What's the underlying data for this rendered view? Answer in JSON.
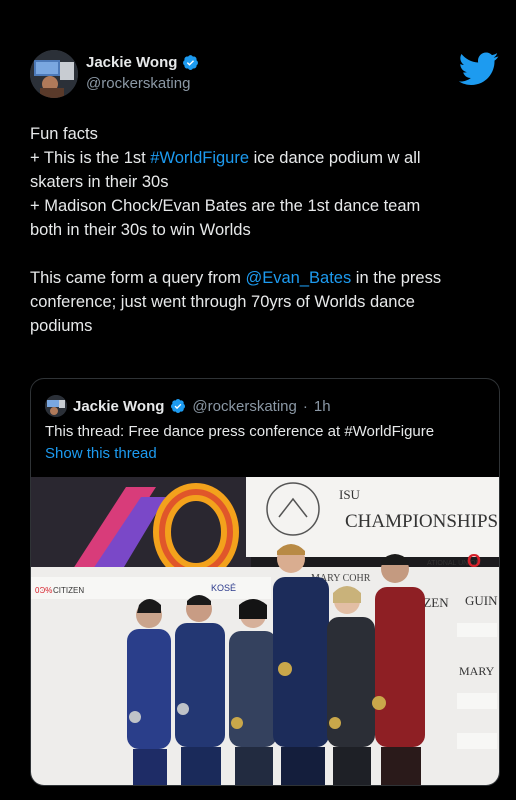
{
  "tweet": {
    "author_name": "Jackie Wong",
    "author_handle": "@rockerskating",
    "line1": "Fun facts",
    "line2_pre": "+ This is the 1st ",
    "line2_link": "#WorldFigure",
    "line2_post": " ice dance podium w all",
    "line3": "skaters in their 30s",
    "line4": "+ Madison Chock/Evan Bates are the 1st dance team",
    "line5": "both in their 30s to win Worlds",
    "line6_pre": "This came form a query from ",
    "line6_link": "@Evan_Bates",
    "line6_post": " in the press",
    "line7": "conference; just went through 70yrs of Worlds dance",
    "line8": "podiums"
  },
  "quote": {
    "author_name": "Jackie Wong",
    "author_handle": "@rockerskating",
    "separator": "·",
    "time": "1h",
    "text": "This thread: Free dance press conference at #WorldFigure",
    "show_thread": "Show this thread"
  },
  "photo": {
    "banner_text": "CHAMPIONSHIPS",
    "isu_text": "ISU",
    "sponsor_mary": "MARY COHR",
    "sponsor_kose": "KOSÉ",
    "sponsor_citizen": "CITIZEN",
    "sponsor_guinot": "GUINOT",
    "sponsor_national": "ATIONAL UNION",
    "sponsor_side_guin": "GUIN",
    "sponsor_side_mary": "MARY",
    "sponsor_side_zen": "IZEN"
  },
  "colors": {
    "background": "#000000",
    "text": "#e7e9ea",
    "muted": "#8b98a5",
    "link": "#1d9bf0",
    "border": "#2f3336"
  },
  "icons": {
    "bird": "twitter-bird-icon",
    "verified": "verified-badge-icon"
  }
}
